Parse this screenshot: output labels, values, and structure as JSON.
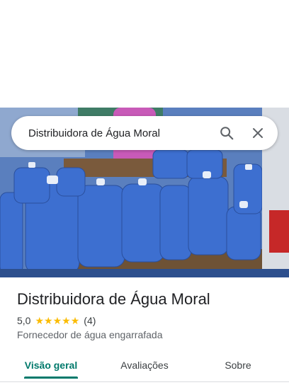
{
  "search": {
    "query": "Distribuidora de Água Moral"
  },
  "place": {
    "name": "Distribuidora de Água Moral",
    "rating": "5,0",
    "stars": 5,
    "review_count": "(4)",
    "category": "Fornecedor de água engarrafada"
  },
  "tabs": [
    {
      "label": "Visão geral",
      "active": true
    },
    {
      "label": "Avaliações",
      "active": false
    },
    {
      "label": "Sobre",
      "active": false
    }
  ],
  "colors": {
    "accent": "#00796b",
    "star": "#fbbc04"
  },
  "icons": {
    "search": "search-icon",
    "close": "close-icon",
    "star": "star-icon"
  }
}
